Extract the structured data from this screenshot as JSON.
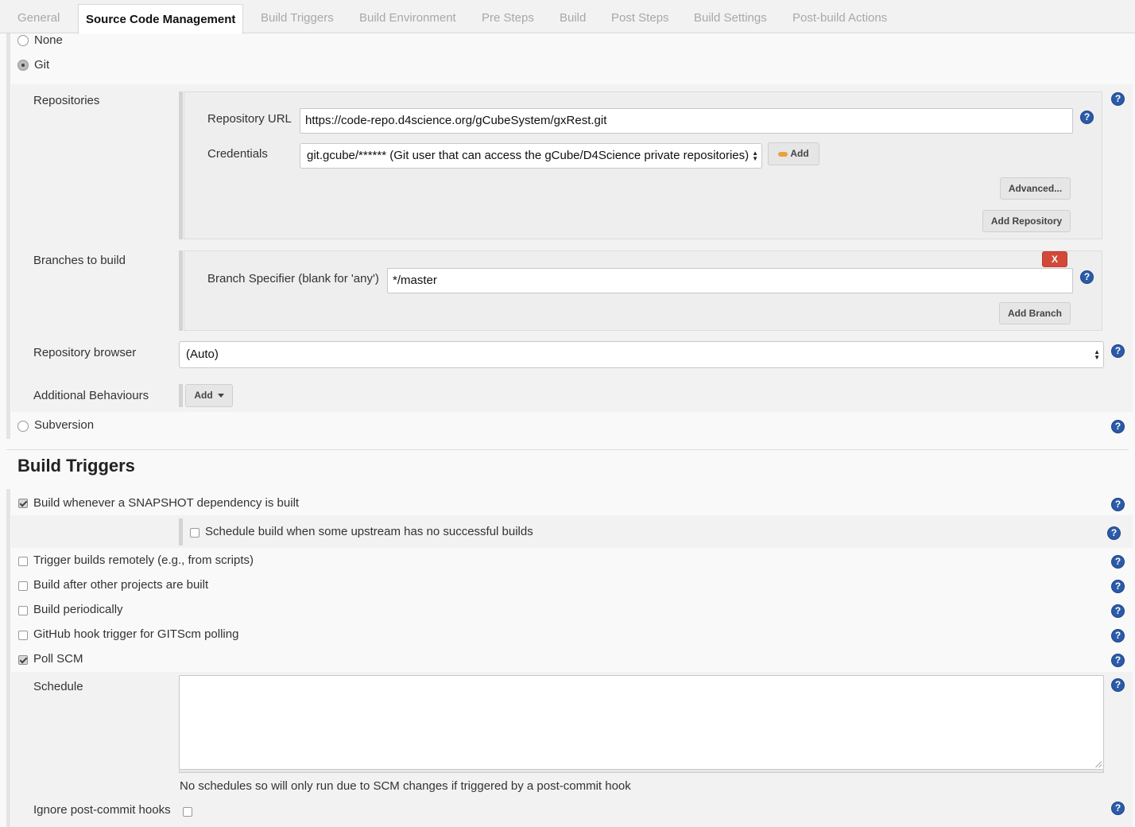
{
  "tabs": [
    {
      "label": "General"
    },
    {
      "label": "Source Code Management"
    },
    {
      "label": "Build Triggers"
    },
    {
      "label": "Build Environment"
    },
    {
      "label": "Pre Steps"
    },
    {
      "label": "Build"
    },
    {
      "label": "Post Steps"
    },
    {
      "label": "Build Settings"
    },
    {
      "label": "Post-build Actions"
    }
  ],
  "scm": {
    "none_label": "None",
    "git_label": "Git",
    "selected": "Git",
    "subversion_label": "Subversion",
    "repositories_label": "Repositories",
    "repo_url_label": "Repository URL",
    "repo_url_value": "https://code-repo.d4science.org/gCubeSystem/gxRest.git",
    "credentials_label": "Credentials",
    "credentials_value": "git.gcube/****** (Git user that can access the gCube/D4Science private repositories)",
    "credentials_add_label": "Add",
    "advanced_label": "Advanced...",
    "add_repository_label": "Add Repository",
    "branches_label": "Branches to build",
    "delete_branch_label": "X",
    "branch_specifier_label": "Branch Specifier (blank for 'any')",
    "branch_specifier_value": "*/master",
    "add_branch_label": "Add Branch",
    "repo_browser_label": "Repository browser",
    "repo_browser_value": "(Auto)",
    "additional_behaviours_label": "Additional Behaviours",
    "add_behaviour_label": "Add"
  },
  "build_triggers": {
    "title": "Build Triggers",
    "snapshot_label": "Build whenever a SNAPSHOT dependency is built",
    "snapshot_checked": true,
    "upstream_label": "Schedule build when some upstream has no successful builds",
    "upstream_checked": false,
    "remote_label": "Trigger builds remotely (e.g., from scripts)",
    "after_other_label": "Build after other projects are built",
    "periodically_label": "Build periodically",
    "github_hook_label": "GitHub hook trigger for GITScm polling",
    "poll_scm_label": "Poll SCM",
    "poll_scm_checked": true,
    "schedule_label": "Schedule",
    "schedule_value": "",
    "schedule_note": "No schedules so will only run due to SCM changes if triggered by a post-commit hook",
    "ignore_hooks_label": "Ignore post-commit hooks",
    "ignore_hooks_checked": false
  },
  "icons": {
    "help": "help-icon",
    "credentials_key": "key-icon"
  },
  "colors": {
    "help": "#2b5aa8",
    "delete": "#d24939",
    "credentials_key": "#e8a33a"
  }
}
